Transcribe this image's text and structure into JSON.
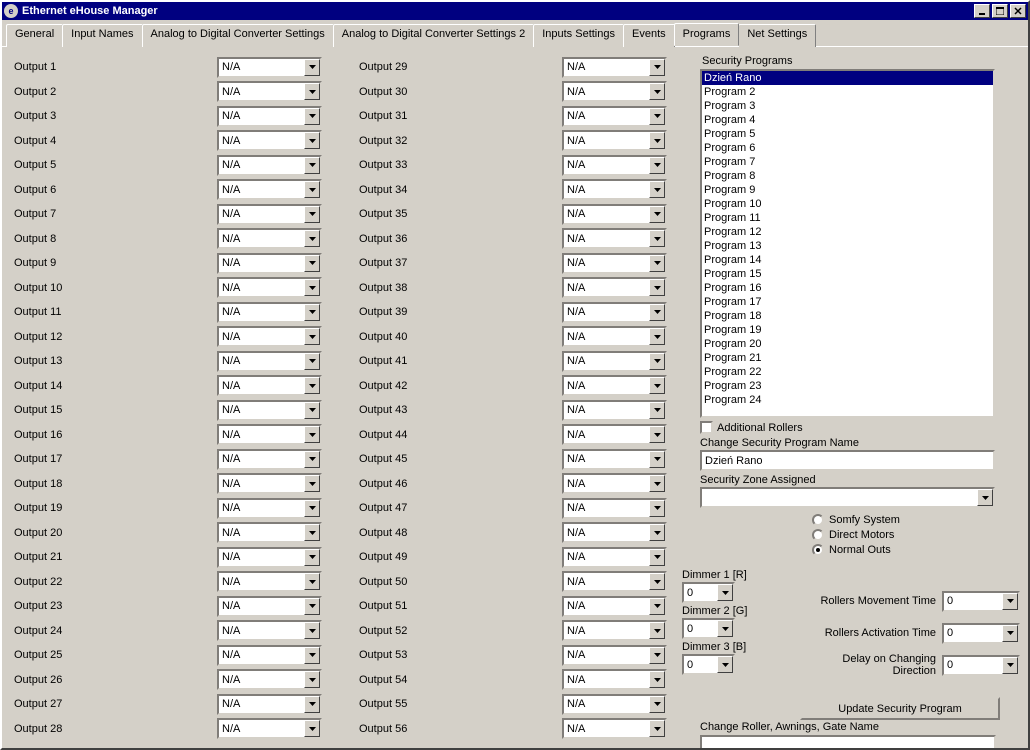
{
  "window": {
    "title": "Ethernet eHouse Manager"
  },
  "tabs": [
    "General",
    "Input Names",
    "Analog to Digital Converter Settings",
    "Analog to Digital Converter Settings 2",
    "Inputs Settings",
    "Events",
    "Programs",
    "Net Settings"
  ],
  "active_tab": 6,
  "dropdown_value": "N/A",
  "outputs_left": [
    "Output 1",
    "Output 2",
    "Output 3",
    "Output 4",
    "Output 5",
    "Output 6",
    "Output 7",
    "Output 8",
    "Output 9",
    "Output 10",
    "Output 11",
    "Output 12",
    "Output 13",
    "Output 14",
    "Output 15",
    "Output 16",
    "Output 17",
    "Output 18",
    "Output 19",
    "Output 20",
    "Output 21",
    "Output 22",
    "Output 23",
    "Output 24",
    "Output 25",
    "Output 26",
    "Output 27",
    "Output 28"
  ],
  "outputs_right": [
    "Output 29",
    "Output 30",
    "Output 31",
    "Output 32",
    "Output 33",
    "Output 34",
    "Output 35",
    "Output 36",
    "Output 37",
    "Output 38",
    "Output 39",
    "Output 40",
    "Output 41",
    "Output 42",
    "Output 43",
    "Output 44",
    "Output 45",
    "Output 46",
    "Output 47",
    "Output 48",
    "Output 49",
    "Output 50",
    "Output 51",
    "Output 52",
    "Output 53",
    "Output 54",
    "Output 55",
    "Output 56"
  ],
  "security": {
    "header": "Security Programs",
    "programs": [
      "Dzień Rano",
      "Program 2",
      "Program 3",
      "Program 4",
      "Program 5",
      "Program 6",
      "Program 7",
      "Program 8",
      "Program 9",
      "Program 10",
      "Program 11",
      "Program 12",
      "Program 13",
      "Program 14",
      "Program 15",
      "Program 16",
      "Program 17",
      "Program 18",
      "Program 19",
      "Program 20",
      "Program 21",
      "Program 22",
      "Program 23",
      "Program 24"
    ],
    "selected": 0,
    "additional_rollers": "Additional Rollers",
    "change_name_label": "Change Security Program Name",
    "name_value": "Dzień Rano",
    "zone_label": "Security Zone Assigned",
    "zone_value": "",
    "radio_options": [
      "Somfy System",
      "Direct Motors",
      "Normal Outs"
    ],
    "radio_selected": 2,
    "dimmers": [
      {
        "label": "Dimmer 1 [R]",
        "value": "0"
      },
      {
        "label": "Dimmer 2 [G]",
        "value": "0"
      },
      {
        "label": "Dimmer 3 [B]",
        "value": "0"
      }
    ],
    "rollers": [
      {
        "label": "Rollers Movement Time",
        "value": "0"
      },
      {
        "label": "Rollers Activation Time",
        "value": "0"
      },
      {
        "label": "Delay on Changing Direction",
        "value": "0"
      }
    ],
    "update_button": "Update Security Program",
    "change_roller_label": "Change Roller, Awnings, Gate Name",
    "roller_name_value": ""
  }
}
